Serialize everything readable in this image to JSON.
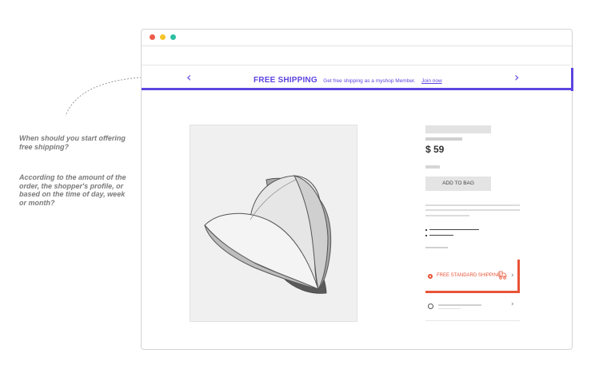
{
  "annotation": {
    "question": "When should you start offering free shipping?",
    "answer": "According to the amount of the order, the shopper's profile, or based on the time of day, week or month?"
  },
  "banner": {
    "headline": "FREE SHIPPING",
    "subtext": "Get free shipping as a myshop Member.",
    "link_text": "Join now",
    "prev_icon": "chevron-left",
    "next_icon": "chevron-right",
    "accent_color": "#5c45e0"
  },
  "product": {
    "price": "$ 59",
    "add_to_bag_label": "ADD TO BAG",
    "image_icon": "baseball-cap"
  },
  "shipping": {
    "selected_option": "FREE STANDARD SHIPPING",
    "icon": "truck-icon",
    "accent_color": "#e95437"
  },
  "window_controls": {
    "colors": [
      "#ee5a4a",
      "#f5c426",
      "#2fbfa2"
    ]
  }
}
